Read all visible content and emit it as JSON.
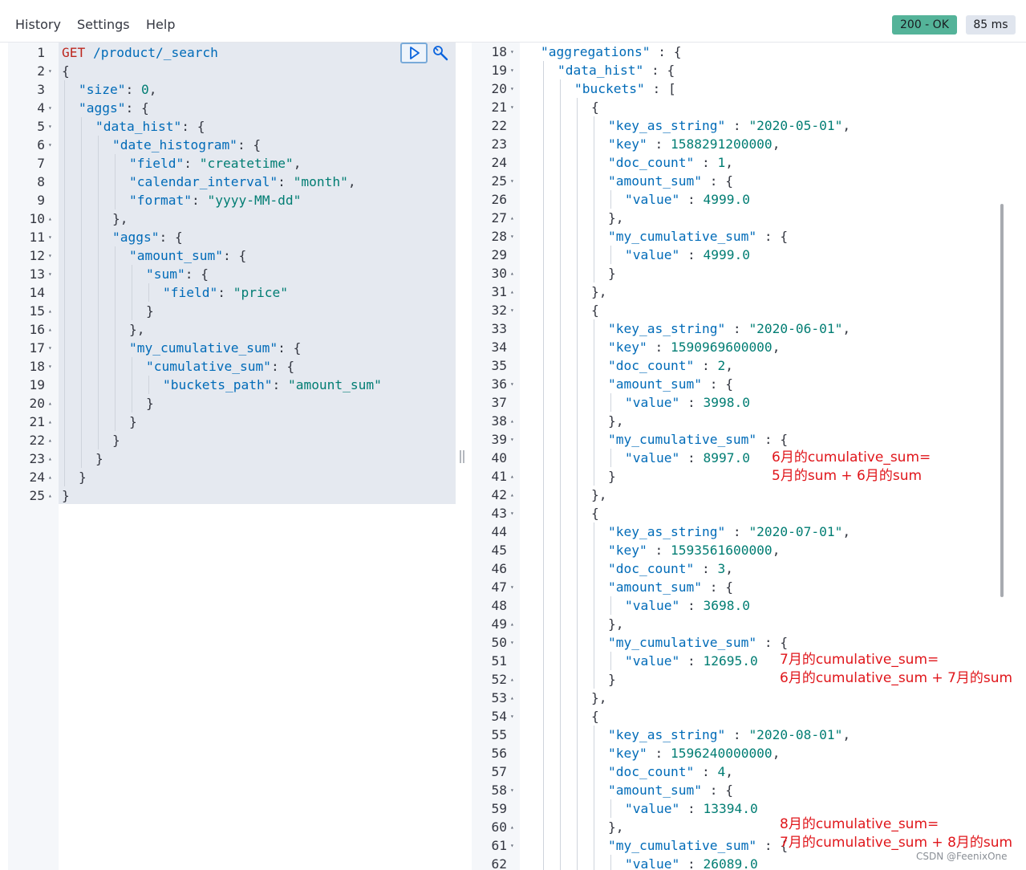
{
  "menu": [
    "History",
    "Settings",
    "Help"
  ],
  "status": {
    "code": "200 - OK",
    "time": "85 ms",
    "ok_color": "#54b399"
  },
  "left_lines": [
    {
      "n": "1",
      "f": "",
      "i": 0,
      "t": [
        [
          "GET",
          "m"
        ],
        [
          " /product/_search",
          "k"
        ]
      ]
    },
    {
      "n": "2",
      "f": "v",
      "i": 0,
      "t": [
        [
          "{",
          ""
        ]
      ]
    },
    {
      "n": "3",
      "f": "",
      "i": 1,
      "t": [
        [
          "\"size\"",
          "k"
        ],
        [
          ": ",
          ""
        ],
        [
          "0",
          "n"
        ],
        [
          ",",
          ""
        ]
      ]
    },
    {
      "n": "4",
      "f": "v",
      "i": 1,
      "t": [
        [
          "\"aggs\"",
          "k"
        ],
        [
          ": {",
          ""
        ]
      ]
    },
    {
      "n": "5",
      "f": "v",
      "i": 2,
      "t": [
        [
          "\"data_hist\"",
          "k"
        ],
        [
          ": {",
          ""
        ]
      ]
    },
    {
      "n": "6",
      "f": "v",
      "i": 3,
      "t": [
        [
          "\"date_histogram\"",
          "k"
        ],
        [
          ": {",
          ""
        ]
      ]
    },
    {
      "n": "7",
      "f": "",
      "i": 4,
      "t": [
        [
          "\"field\"",
          "k"
        ],
        [
          ": ",
          ""
        ],
        [
          "\"createtime\"",
          "s"
        ],
        [
          ",",
          ""
        ]
      ]
    },
    {
      "n": "8",
      "f": "",
      "i": 4,
      "t": [
        [
          "\"calendar_interval\"",
          "k"
        ],
        [
          ": ",
          ""
        ],
        [
          "\"month\"",
          "s"
        ],
        [
          ",",
          ""
        ]
      ]
    },
    {
      "n": "9",
      "f": "",
      "i": 4,
      "t": [
        [
          "\"format\"",
          "k"
        ],
        [
          ": ",
          ""
        ],
        [
          "\"yyyy-MM-dd\"",
          "s"
        ]
      ]
    },
    {
      "n": "10",
      "f": "^",
      "i": 3,
      "t": [
        [
          "},",
          ""
        ]
      ]
    },
    {
      "n": "11",
      "f": "v",
      "i": 3,
      "t": [
        [
          "\"aggs\"",
          "k"
        ],
        [
          ": {",
          ""
        ]
      ]
    },
    {
      "n": "12",
      "f": "v",
      "i": 4,
      "t": [
        [
          "\"amount_sum\"",
          "k"
        ],
        [
          ": {",
          ""
        ]
      ]
    },
    {
      "n": "13",
      "f": "v",
      "i": 5,
      "t": [
        [
          "\"sum\"",
          "k"
        ],
        [
          ": {",
          ""
        ]
      ]
    },
    {
      "n": "14",
      "f": "",
      "i": 6,
      "t": [
        [
          "\"field\"",
          "k"
        ],
        [
          ": ",
          ""
        ],
        [
          "\"price\"",
          "s"
        ]
      ]
    },
    {
      "n": "15",
      "f": "^",
      "i": 5,
      "t": [
        [
          "}",
          ""
        ]
      ]
    },
    {
      "n": "16",
      "f": "^",
      "i": 4,
      "t": [
        [
          "},",
          ""
        ]
      ]
    },
    {
      "n": "17",
      "f": "v",
      "i": 4,
      "t": [
        [
          "\"my_cumulative_sum\"",
          "k"
        ],
        [
          ": {",
          ""
        ]
      ]
    },
    {
      "n": "18",
      "f": "v",
      "i": 5,
      "t": [
        [
          "\"cumulative_sum\"",
          "k"
        ],
        [
          ": {",
          ""
        ]
      ]
    },
    {
      "n": "19",
      "f": "",
      "i": 6,
      "t": [
        [
          "\"buckets_path\"",
          "k"
        ],
        [
          ": ",
          ""
        ],
        [
          "\"amount_sum\"",
          "s"
        ]
      ]
    },
    {
      "n": "20",
      "f": "^",
      "i": 5,
      "t": [
        [
          "}",
          ""
        ]
      ]
    },
    {
      "n": "21",
      "f": "^",
      "i": 4,
      "t": [
        [
          "}",
          ""
        ]
      ]
    },
    {
      "n": "22",
      "f": "^",
      "i": 3,
      "t": [
        [
          "}",
          ""
        ]
      ]
    },
    {
      "n": "23",
      "f": "^",
      "i": 2,
      "t": [
        [
          "}",
          ""
        ]
      ]
    },
    {
      "n": "24",
      "f": "^",
      "i": 1,
      "t": [
        [
          "}",
          ""
        ]
      ]
    },
    {
      "n": "25",
      "f": "^",
      "i": 0,
      "t": [
        [
          "}",
          ""
        ]
      ]
    }
  ],
  "right_lines": [
    {
      "n": "18",
      "f": "v",
      "i": 0,
      "t": [
        [
          "\"aggregations\"",
          "k"
        ],
        [
          " : {",
          ""
        ]
      ]
    },
    {
      "n": "19",
      "f": "v",
      "i": 1,
      "t": [
        [
          "\"data_hist\"",
          "k"
        ],
        [
          " : {",
          ""
        ]
      ]
    },
    {
      "n": "20",
      "f": "v",
      "i": 2,
      "t": [
        [
          "\"buckets\"",
          "k"
        ],
        [
          " : [",
          ""
        ]
      ]
    },
    {
      "n": "21",
      "f": "v",
      "i": 3,
      "t": [
        [
          "{",
          ""
        ]
      ]
    },
    {
      "n": "22",
      "f": "",
      "i": 4,
      "t": [
        [
          "\"key_as_string\"",
          "k"
        ],
        [
          " : ",
          ""
        ],
        [
          "\"2020-05-01\"",
          "s"
        ],
        [
          ",",
          ""
        ]
      ]
    },
    {
      "n": "23",
      "f": "",
      "i": 4,
      "t": [
        [
          "\"key\"",
          "k"
        ],
        [
          " : ",
          ""
        ],
        [
          "1588291200000",
          "n"
        ],
        [
          ",",
          ""
        ]
      ]
    },
    {
      "n": "24",
      "f": "",
      "i": 4,
      "t": [
        [
          "\"doc_count\"",
          "k"
        ],
        [
          " : ",
          ""
        ],
        [
          "1",
          "n"
        ],
        [
          ",",
          ""
        ]
      ]
    },
    {
      "n": "25",
      "f": "v",
      "i": 4,
      "t": [
        [
          "\"amount_sum\"",
          "k"
        ],
        [
          " : {",
          ""
        ]
      ]
    },
    {
      "n": "26",
      "f": "",
      "i": 5,
      "t": [
        [
          "\"value\"",
          "k"
        ],
        [
          " : ",
          ""
        ],
        [
          "4999.0",
          "n"
        ]
      ]
    },
    {
      "n": "27",
      "f": "^",
      "i": 4,
      "t": [
        [
          "},",
          ""
        ]
      ]
    },
    {
      "n": "28",
      "f": "v",
      "i": 4,
      "t": [
        [
          "\"my_cumulative_sum\"",
          "k"
        ],
        [
          " : {",
          ""
        ]
      ]
    },
    {
      "n": "29",
      "f": "",
      "i": 5,
      "t": [
        [
          "\"value\"",
          "k"
        ],
        [
          " : ",
          ""
        ],
        [
          "4999.0",
          "n"
        ]
      ]
    },
    {
      "n": "30",
      "f": "^",
      "i": 4,
      "t": [
        [
          "}",
          ""
        ]
      ]
    },
    {
      "n": "31",
      "f": "^",
      "i": 3,
      "t": [
        [
          "},",
          ""
        ]
      ]
    },
    {
      "n": "32",
      "f": "v",
      "i": 3,
      "t": [
        [
          "{",
          ""
        ]
      ]
    },
    {
      "n": "33",
      "f": "",
      "i": 4,
      "t": [
        [
          "\"key_as_string\"",
          "k"
        ],
        [
          " : ",
          ""
        ],
        [
          "\"2020-06-01\"",
          "s"
        ],
        [
          ",",
          ""
        ]
      ]
    },
    {
      "n": "34",
      "f": "",
      "i": 4,
      "t": [
        [
          "\"key\"",
          "k"
        ],
        [
          " : ",
          ""
        ],
        [
          "1590969600000",
          "n"
        ],
        [
          ",",
          ""
        ]
      ]
    },
    {
      "n": "35",
      "f": "",
      "i": 4,
      "t": [
        [
          "\"doc_count\"",
          "k"
        ],
        [
          " : ",
          ""
        ],
        [
          "2",
          "n"
        ],
        [
          ",",
          ""
        ]
      ]
    },
    {
      "n": "36",
      "f": "v",
      "i": 4,
      "t": [
        [
          "\"amount_sum\"",
          "k"
        ],
        [
          " : {",
          ""
        ]
      ]
    },
    {
      "n": "37",
      "f": "",
      "i": 5,
      "t": [
        [
          "\"value\"",
          "k"
        ],
        [
          " : ",
          ""
        ],
        [
          "3998.0",
          "n"
        ]
      ]
    },
    {
      "n": "38",
      "f": "^",
      "i": 4,
      "t": [
        [
          "},",
          ""
        ]
      ]
    },
    {
      "n": "39",
      "f": "v",
      "i": 4,
      "t": [
        [
          "\"my_cumulative_sum\"",
          "k"
        ],
        [
          " : {",
          ""
        ]
      ]
    },
    {
      "n": "40",
      "f": "",
      "i": 5,
      "t": [
        [
          "\"value\"",
          "k"
        ],
        [
          " : ",
          ""
        ],
        [
          "8997.0",
          "n"
        ]
      ]
    },
    {
      "n": "41",
      "f": "^",
      "i": 4,
      "t": [
        [
          "}",
          ""
        ]
      ]
    },
    {
      "n": "42",
      "f": "^",
      "i": 3,
      "t": [
        [
          "},",
          ""
        ]
      ]
    },
    {
      "n": "43",
      "f": "v",
      "i": 3,
      "t": [
        [
          "{",
          ""
        ]
      ]
    },
    {
      "n": "44",
      "f": "",
      "i": 4,
      "t": [
        [
          "\"key_as_string\"",
          "k"
        ],
        [
          " : ",
          ""
        ],
        [
          "\"2020-07-01\"",
          "s"
        ],
        [
          ",",
          ""
        ]
      ]
    },
    {
      "n": "45",
      "f": "",
      "i": 4,
      "t": [
        [
          "\"key\"",
          "k"
        ],
        [
          " : ",
          ""
        ],
        [
          "1593561600000",
          "n"
        ],
        [
          ",",
          ""
        ]
      ]
    },
    {
      "n": "46",
      "f": "",
      "i": 4,
      "t": [
        [
          "\"doc_count\"",
          "k"
        ],
        [
          " : ",
          ""
        ],
        [
          "3",
          "n"
        ],
        [
          ",",
          ""
        ]
      ]
    },
    {
      "n": "47",
      "f": "v",
      "i": 4,
      "t": [
        [
          "\"amount_sum\"",
          "k"
        ],
        [
          " : {",
          ""
        ]
      ]
    },
    {
      "n": "48",
      "f": "",
      "i": 5,
      "t": [
        [
          "\"value\"",
          "k"
        ],
        [
          " : ",
          ""
        ],
        [
          "3698.0",
          "n"
        ]
      ]
    },
    {
      "n": "49",
      "f": "^",
      "i": 4,
      "t": [
        [
          "},",
          ""
        ]
      ]
    },
    {
      "n": "50",
      "f": "v",
      "i": 4,
      "t": [
        [
          "\"my_cumulative_sum\"",
          "k"
        ],
        [
          " : {",
          ""
        ]
      ]
    },
    {
      "n": "51",
      "f": "",
      "i": 5,
      "t": [
        [
          "\"value\"",
          "k"
        ],
        [
          " : ",
          ""
        ],
        [
          "12695.0",
          "n"
        ]
      ]
    },
    {
      "n": "52",
      "f": "^",
      "i": 4,
      "t": [
        [
          "}",
          ""
        ]
      ]
    },
    {
      "n": "53",
      "f": "^",
      "i": 3,
      "t": [
        [
          "},",
          ""
        ]
      ]
    },
    {
      "n": "54",
      "f": "v",
      "i": 3,
      "t": [
        [
          "{",
          ""
        ]
      ]
    },
    {
      "n": "55",
      "f": "",
      "i": 4,
      "t": [
        [
          "\"key_as_string\"",
          "k"
        ],
        [
          " : ",
          ""
        ],
        [
          "\"2020-08-01\"",
          "s"
        ],
        [
          ",",
          ""
        ]
      ]
    },
    {
      "n": "56",
      "f": "",
      "i": 4,
      "t": [
        [
          "\"key\"",
          "k"
        ],
        [
          " : ",
          ""
        ],
        [
          "1596240000000",
          "n"
        ],
        [
          ",",
          ""
        ]
      ]
    },
    {
      "n": "57",
      "f": "",
      "i": 4,
      "t": [
        [
          "\"doc_count\"",
          "k"
        ],
        [
          " : ",
          ""
        ],
        [
          "4",
          "n"
        ],
        [
          ",",
          ""
        ]
      ]
    },
    {
      "n": "58",
      "f": "v",
      "i": 4,
      "t": [
        [
          "\"amount_sum\"",
          "k"
        ],
        [
          " : {",
          ""
        ]
      ]
    },
    {
      "n": "59",
      "f": "",
      "i": 5,
      "t": [
        [
          "\"value\"",
          "k"
        ],
        [
          " : ",
          ""
        ],
        [
          "13394.0",
          "n"
        ]
      ]
    },
    {
      "n": "60",
      "f": "^",
      "i": 4,
      "t": [
        [
          "},",
          ""
        ]
      ]
    },
    {
      "n": "61",
      "f": "v",
      "i": 4,
      "t": [
        [
          "\"my_cumulative_sum\"",
          "k"
        ],
        [
          " : {",
          ""
        ]
      ]
    },
    {
      "n": "62",
      "f": "",
      "i": 5,
      "t": [
        [
          "\"value\"",
          "k"
        ],
        [
          " : ",
          ""
        ],
        [
          "26089.0",
          "n"
        ]
      ]
    }
  ],
  "annotations": [
    {
      "line1": "6月的cumulative_sum=",
      "line2": "5月的sum + 6月的sum"
    },
    {
      "line1": "7月的cumulative_sum=",
      "line2": "6月的cumulative_sum + 7月的sum"
    },
    {
      "line1": "8月的cumulative_sum=",
      "line2": "7月的cumulative_sum + 8月的sum"
    }
  ],
  "annotation_color": "#e0161b",
  "watermark": "CSDN @FeenixOne",
  "icons": {
    "run": "play-icon",
    "wrench": "wrench-icon"
  }
}
